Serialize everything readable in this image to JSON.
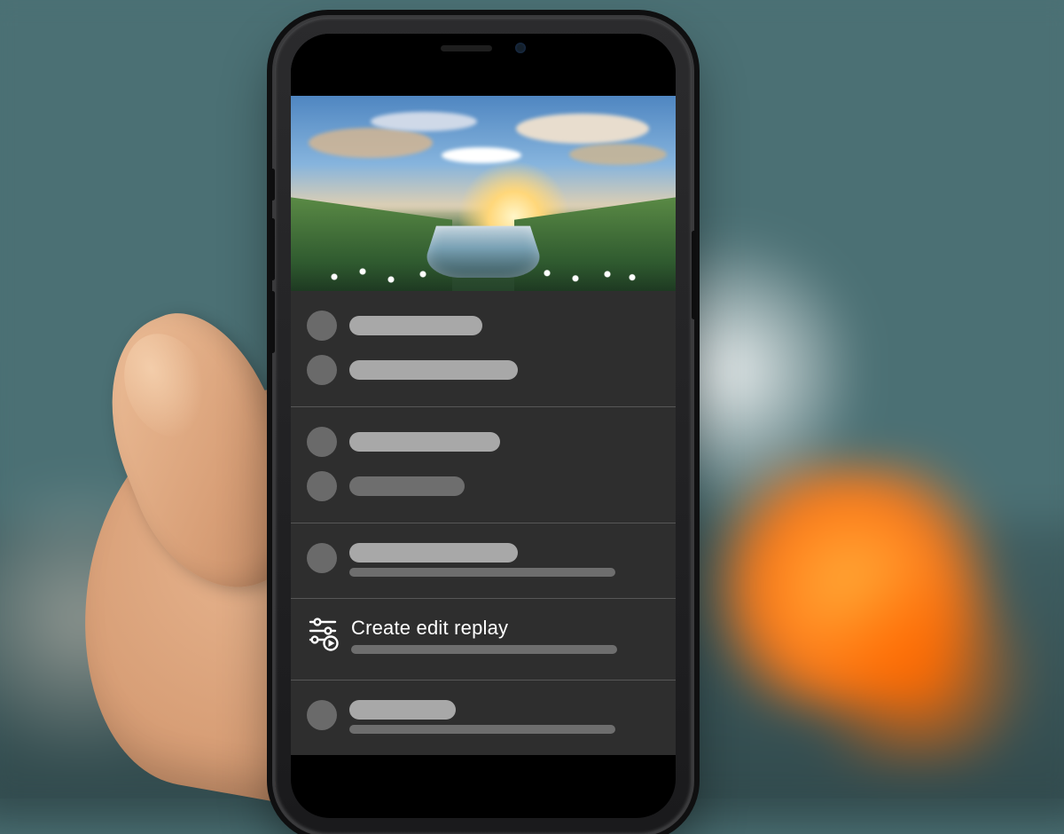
{
  "share_menu": {
    "create_edit_replay_label": "Create edit replay"
  }
}
